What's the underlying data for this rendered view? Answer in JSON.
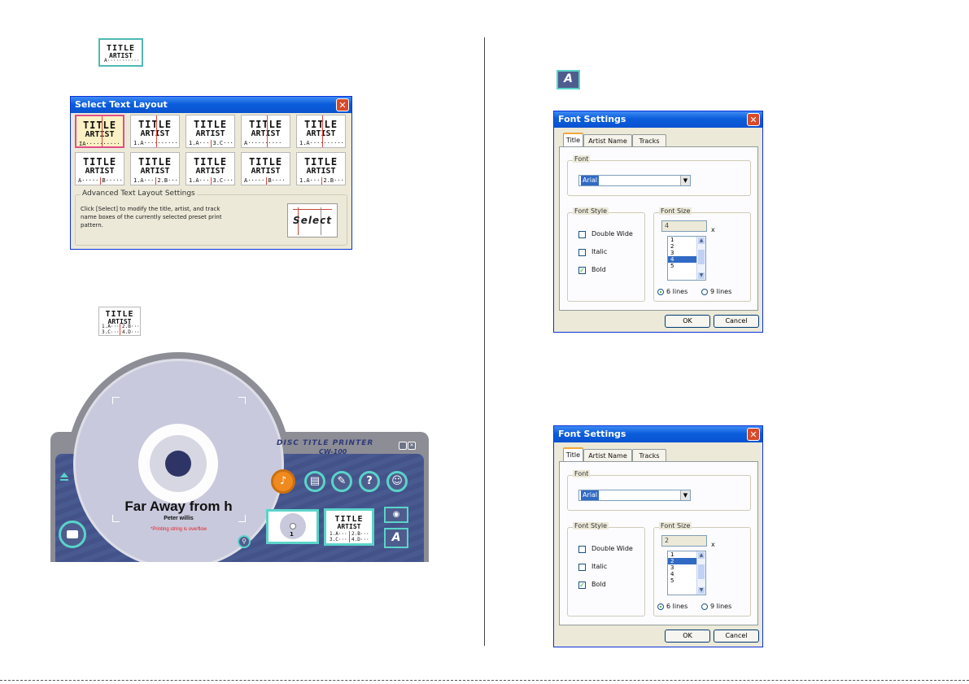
{
  "layout_icon_1": {
    "title": "TITLE",
    "artist": "ARTIST",
    "lines": [
      [
        "A···········"
      ],
      [
        "B··········"
      ]
    ]
  },
  "select_layout_dialog": {
    "title": "Select Text Layout",
    "close": "✕",
    "layouts": [
      {
        "lines": [
          [
            "IA··········"
          ],
          [
            "IB·········"
          ]
        ]
      },
      {
        "lines": [
          [
            "1.A···········"
          ],
          [
            "2.B·······"
          ]
        ]
      },
      {
        "lines": [
          [
            "1.A···",
            "3.C···"
          ],
          [
            "2.B···",
            "4.D···"
          ]
        ]
      },
      {
        "lines": [
          [
            "A··········"
          ],
          [
            "B·······"
          ]
        ]
      },
      {
        "lines": [
          [
            "1.A··········"
          ],
          [
            "2.B·······"
          ]
        ]
      },
      {
        "lines": [
          [
            "A······",
            "B·····"
          ],
          [
            "C······",
            "D·····"
          ]
        ]
      },
      {
        "lines": [
          [
            "1.A····",
            "2.B····"
          ],
          [
            "3.C····",
            "4.D····"
          ]
        ]
      },
      {
        "lines": [
          [
            "1.A···",
            "3.C···"
          ],
          [
            "2.B···",
            "4.D···"
          ]
        ]
      },
      {
        "lines": [
          [
            "A·····",
            "B····"
          ],
          [
            "C·····",
            "D····"
          ]
        ]
      },
      {
        "lines": [
          [
            "1.A···",
            "2.B···"
          ],
          [
            "3.C···",
            "4.D···"
          ]
        ]
      }
    ],
    "advanced_group": "Advanced Text Layout Settings",
    "advanced_text": "Click [Select] to modify the title, artist, and track name boxes of the currently selected preset print pattern.",
    "select_button": "Select"
  },
  "layout_icon_2": {
    "title": "TITLE",
    "artist": "ARTIST",
    "lines": [
      [
        "1.A···",
        "2.B···"
      ],
      [
        "3.C···",
        "4.D···"
      ]
    ]
  },
  "font_icon": {
    "glyph": "A"
  },
  "font_dialogs": [
    {
      "title": "Font Settings",
      "tabs": [
        "Title",
        "Artist Name",
        "Tracks"
      ],
      "font_group": "Font",
      "font_value": "Arial",
      "style_group": "Font Style",
      "styles": [
        {
          "label": "Double Wide",
          "checked": false
        },
        {
          "label": "Italic",
          "checked": false
        },
        {
          "label": "Bold",
          "checked": true
        }
      ],
      "size_group": "Font Size",
      "size_value": "4",
      "size_unit": "x",
      "size_items": [
        "1",
        "2",
        "3",
        "4",
        "5"
      ],
      "size_selected": "4",
      "radio_6": "6 lines",
      "radio_9": "9 lines",
      "ok": "OK",
      "cancel": "Cancel"
    },
    {
      "title": "Font Settings",
      "tabs": [
        "Title",
        "Artist Name",
        "Tracks"
      ],
      "font_group": "Font",
      "font_value": "Arial",
      "style_group": "Font Style",
      "styles": [
        {
          "label": "Double Wide",
          "checked": false
        },
        {
          "label": "Italic",
          "checked": false
        },
        {
          "label": "Bold",
          "checked": true
        }
      ],
      "size_group": "Font Size",
      "size_value": "2",
      "size_unit": "x",
      "size_items": [
        "1",
        "2",
        "3",
        "4",
        "5"
      ],
      "size_selected": "2",
      "radio_6": "6 lines",
      "radio_9": "9 lines",
      "ok": "OK",
      "cancel": "Cancel"
    }
  ],
  "disc_app": {
    "brand_line1": "DISC TITLE PRINTER",
    "brand_line2": "CW-100",
    "disc_title": "Far Away from h",
    "disc_artist": "Peter willis",
    "disc_warning": "*Printing string is overflow",
    "disc_count": "1",
    "preview": {
      "title": "TITLE",
      "artist": "ARTIST",
      "lines": [
        [
          "1.A···",
          "2.B···"
        ],
        [
          "3.C···",
          "4.D···"
        ]
      ]
    },
    "font_button": "A",
    "colors": {
      "panel": "#495a90",
      "accent": "#5ad4c9",
      "disc": "#c9c9dd",
      "orange": "#f08a1e"
    }
  }
}
